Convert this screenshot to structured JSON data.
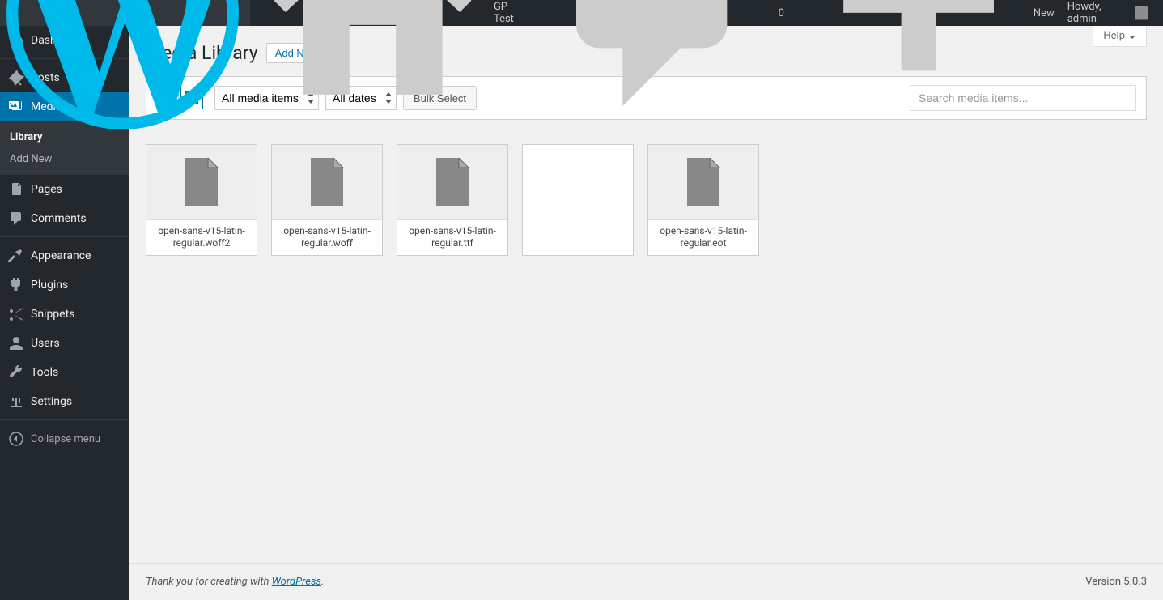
{
  "adminbar": {
    "site_name": "GP Test",
    "comments_count": "0",
    "new_label": "New",
    "howdy": "Howdy, admin"
  },
  "sidebar": {
    "items": [
      {
        "label": "Dashboard"
      },
      {
        "label": "Posts"
      },
      {
        "label": "Media"
      },
      {
        "label": "Pages"
      },
      {
        "label": "Comments"
      },
      {
        "label": "Appearance"
      },
      {
        "label": "Plugins"
      },
      {
        "label": "Snippets"
      },
      {
        "label": "Users"
      },
      {
        "label": "Tools"
      },
      {
        "label": "Settings"
      }
    ],
    "media_sub": {
      "library": "Library",
      "add_new": "Add New"
    },
    "collapse": "Collapse menu"
  },
  "page": {
    "title": "Media Library",
    "add_new": "Add New",
    "help": "Help"
  },
  "toolbar": {
    "filter_media": "All media items",
    "filter_dates": "All dates",
    "bulk_select": "Bulk Select",
    "search_placeholder": "Search media items..."
  },
  "media_items": [
    {
      "filename": "open-sans-v15-latin-regular.woff2",
      "has_label": true
    },
    {
      "filename": "open-sans-v15-latin-regular.woff",
      "has_label": true
    },
    {
      "filename": "open-sans-v15-latin-regular.ttf",
      "has_label": true
    },
    {
      "filename": "",
      "has_label": false
    },
    {
      "filename": "open-sans-v15-latin-regular.eot",
      "has_label": true
    }
  ],
  "footer": {
    "thank_you_prefix": "Thank you for creating with ",
    "wordpress_link": "WordPress",
    "thank_you_suffix": ".",
    "version": "Version 5.0.3"
  }
}
